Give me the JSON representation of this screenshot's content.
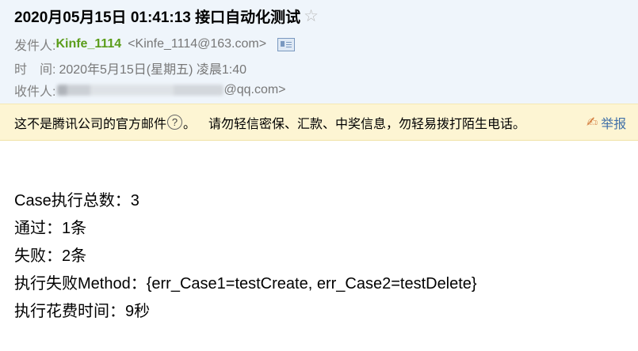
{
  "subject": "2020月05月15日 01:41:13 接口自动化测试",
  "sender": {
    "label": "发件人:",
    "name": "Kinfe_1114",
    "email": "<Kinfe_1114@163.com>"
  },
  "time": {
    "label": "时　间:",
    "value": "2020年5月15日(星期五) 凌晨1:40"
  },
  "recipient": {
    "label": "收件人:",
    "value_tail": "@qq.com>"
  },
  "notice": {
    "text": "这不是腾讯公司的官方邮件",
    "help_symbol": "?",
    "suffix": "。",
    "warning": "请勿轻信密保、汇款、中奖信息，勿轻易拨打陌生电话。",
    "report_label": "举报"
  },
  "body": [
    "Case执行总数：3",
    "通过：1条",
    "失败：2条",
    "执行失败Method：{err_Case1=testCreate, err_Case2=testDelete}",
    "执行花费时间：9秒"
  ],
  "colors": {
    "header_bg": "#eff5fb",
    "notice_bg": "#fdf5d3",
    "sender_name": "#5b9d1a"
  },
  "icons": [
    "star-icon",
    "contact-card-icon",
    "help-icon",
    "report-icon"
  ]
}
